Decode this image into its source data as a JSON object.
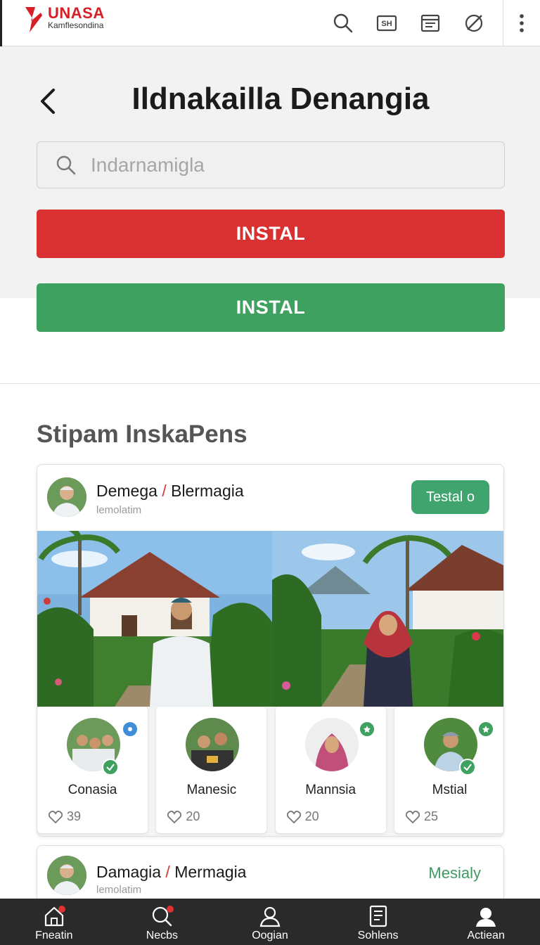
{
  "app": {
    "brand_name": "UNASA",
    "brand_sub": "Kamflesondina"
  },
  "topbar": {
    "icons": [
      "search-icon",
      "sim-card-icon",
      "card-icon",
      "no-signal-icon",
      "more-vertical-icon"
    ],
    "sim_label": "SH"
  },
  "header": {
    "title": "Ildnakailla Denangia"
  },
  "search": {
    "placeholder": "Indarnamigla"
  },
  "actions": {
    "primary_label": "INSTAL",
    "secondary_label": "INSTAL"
  },
  "section": {
    "title": "Stipam InskaPens"
  },
  "colors": {
    "brand_red": "#d93032",
    "accent_green": "#3fa160",
    "nav_dark": "#2a2a2a"
  },
  "cards": [
    {
      "title_a": "Demega",
      "title_b": "Blermagia",
      "subtitle": "lemolatim",
      "pill_label": "Testal o",
      "tiles": [
        {
          "name": "Conasia",
          "likes": "39"
        },
        {
          "name": "Manesic",
          "likes": "20"
        },
        {
          "name": "Mannsia",
          "likes": "20"
        },
        {
          "name": "Mstial",
          "likes": "25"
        }
      ]
    },
    {
      "title_a": "Damagia",
      "title_b": "Mermagia",
      "subtitle": "lemolatim",
      "link_label": "Mesialy"
    }
  ],
  "bottom_nav": [
    {
      "label": "Fneatin",
      "icon": "home-icon"
    },
    {
      "label": "Necbs",
      "icon": "search-icon"
    },
    {
      "label": "Oogian",
      "icon": "user-icon"
    },
    {
      "label": "Sohlens",
      "icon": "document-icon"
    },
    {
      "label": "Actiean",
      "icon": "account-icon"
    }
  ]
}
